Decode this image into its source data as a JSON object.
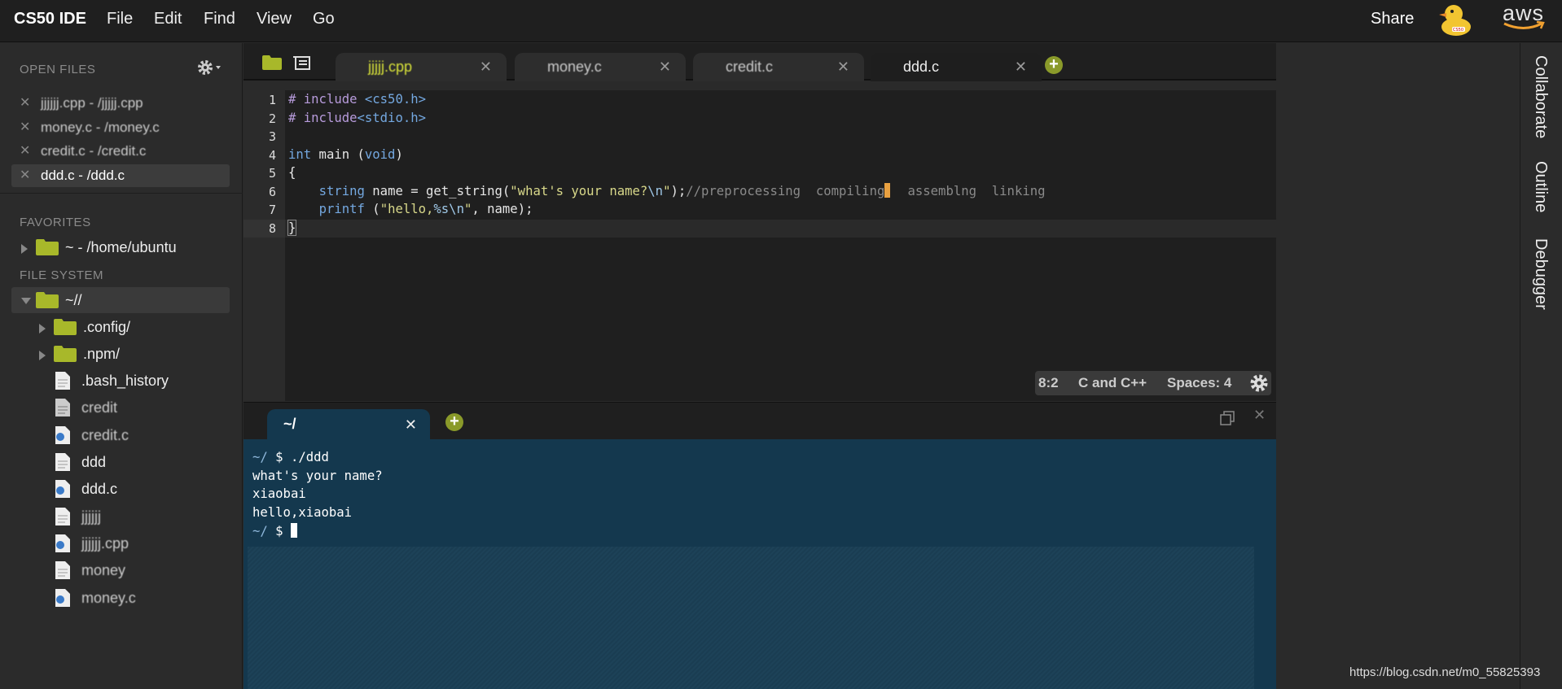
{
  "menubar": {
    "brand": "CS50 IDE",
    "items": [
      "File",
      "Edit",
      "Find",
      "View",
      "Go"
    ],
    "share": "Share",
    "aws": "aws"
  },
  "sidebar": {
    "open_files_title": "OPEN FILES",
    "open_files": [
      {
        "label": "jjjjjj.cpp - /jjjjj.cpp",
        "obscured": true
      },
      {
        "label": "money.c - /money.c",
        "obscured": true
      },
      {
        "label": "credit.c - /credit.c",
        "obscured": true
      },
      {
        "label": "ddd.c - /ddd.c",
        "obscured": false,
        "active": true
      }
    ],
    "favorites_title": "FAVORITES",
    "favorites": [
      {
        "label": "~ - /home/ubuntu"
      }
    ],
    "filesystem_title": "FILE SYSTEM",
    "tree": [
      {
        "label": "~//",
        "type": "folder-open"
      },
      {
        "label": ".config/",
        "type": "folder"
      },
      {
        "label": ".npm/",
        "type": "folder"
      },
      {
        "label": ".bash_history",
        "type": "file"
      },
      {
        "label": "credit",
        "type": "file",
        "obscured": true
      },
      {
        "label": "credit.c",
        "type": "c-file",
        "obscured": true
      },
      {
        "label": "ddd",
        "type": "file"
      },
      {
        "label": "ddd.c",
        "type": "c-file"
      },
      {
        "label": "jjjjjj",
        "type": "file",
        "obscured": true
      },
      {
        "label": "jjjjjj.cpp",
        "type": "cpp-file",
        "obscured": true
      },
      {
        "label": "money",
        "type": "file",
        "obscured": true
      },
      {
        "label": "money.c",
        "type": "c-file",
        "obscured": true
      }
    ]
  },
  "editor": {
    "tabs": [
      {
        "label": "jjjjj.cpp",
        "obscured": true
      },
      {
        "label": "money.c",
        "obscured": true
      },
      {
        "label": "credit.c",
        "obscured": true
      },
      {
        "label": "ddd.c",
        "active": true
      }
    ],
    "line_numbers": [
      "1",
      "2",
      "3",
      "4",
      "5",
      "6",
      "7",
      "8"
    ],
    "status": {
      "position": "8:2",
      "mode": "C and C++",
      "spaces": "Spaces: 4"
    }
  },
  "terminal": {
    "tab_label": "~/",
    "lines": [
      {
        "prompt": "~/",
        "text": " $ ./ddd"
      },
      {
        "prompt": "",
        "text": "what's your name?"
      },
      {
        "prompt": "",
        "text": "xiaobai"
      },
      {
        "prompt": "",
        "text": "hello,xiaobai"
      },
      {
        "prompt": "~/",
        "text": " $ "
      }
    ]
  },
  "right_rail": [
    "Collaborate",
    "Outline",
    "Debugger"
  ],
  "watermark": "https://blog.csdn.net/m0_55825393",
  "colors": {
    "accent_green": "#8a9a2a",
    "folder": "#a8b82a",
    "terminal_bg": "#14384e"
  }
}
